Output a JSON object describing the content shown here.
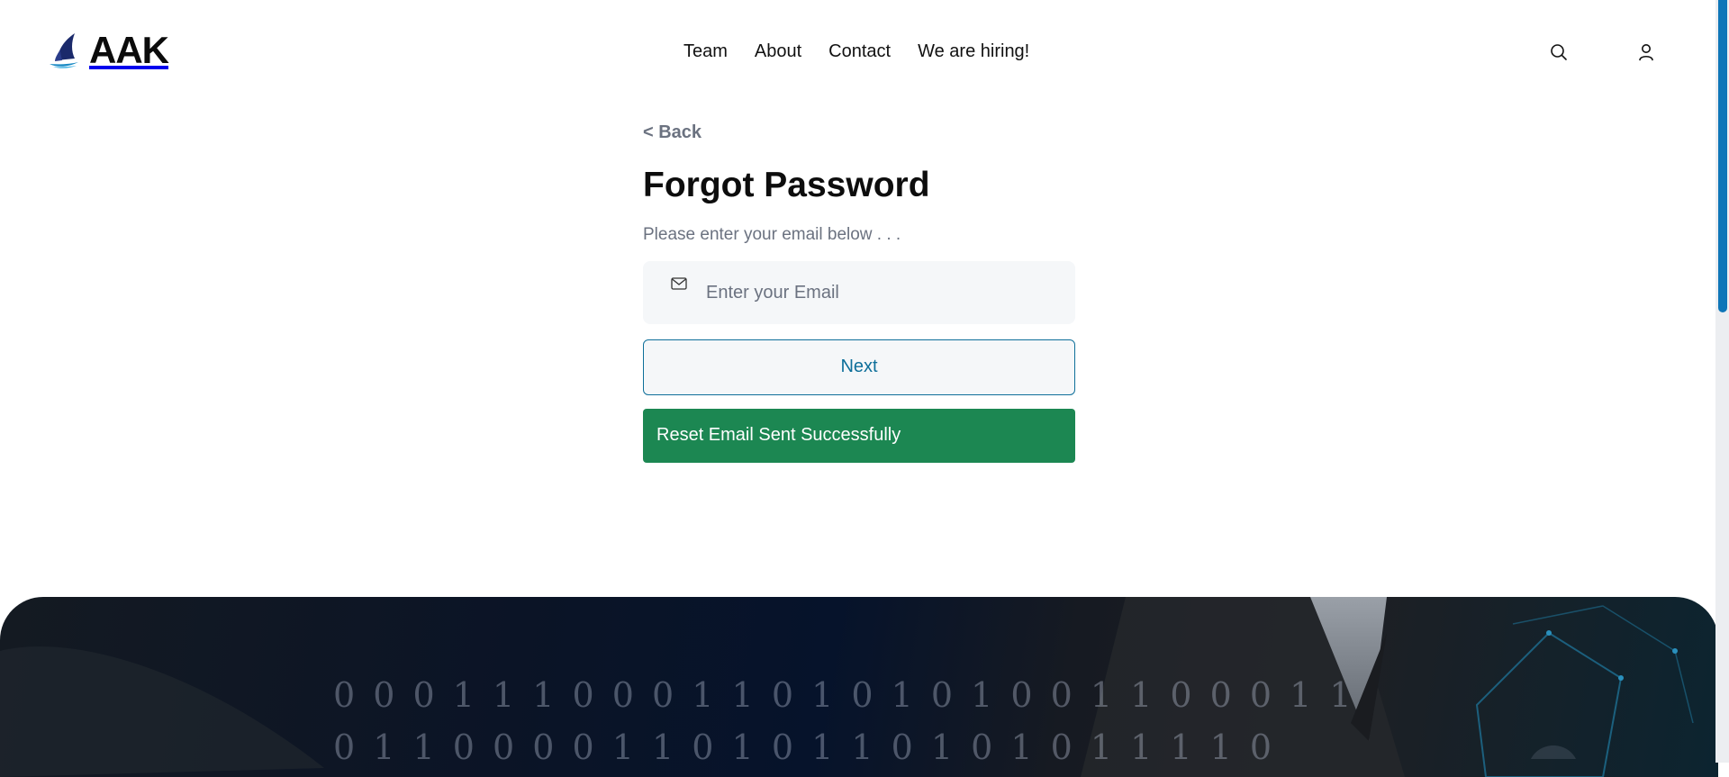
{
  "header": {
    "logo_text": "AAK",
    "nav": [
      {
        "label": "Team"
      },
      {
        "label": "About"
      },
      {
        "label": "Contact"
      },
      {
        "label": "We are hiring!"
      }
    ],
    "icons": [
      "search-icon",
      "user-icon"
    ]
  },
  "form": {
    "back_label": "< Back",
    "title": "Forgot Password",
    "subtitle": "Please enter your email below . . .",
    "email": {
      "placeholder": "Enter your Email",
      "value": "",
      "icon": "mail-icon"
    },
    "next_label": "Next",
    "alert_text": "Reset Email Sent Successfully"
  },
  "colors": {
    "accent": "#0e6f9a",
    "success": "#1c8752",
    "muted_text": "#6b7280",
    "input_bg": "#f5f7f9",
    "scroll_thumb": "#0e76b8"
  }
}
